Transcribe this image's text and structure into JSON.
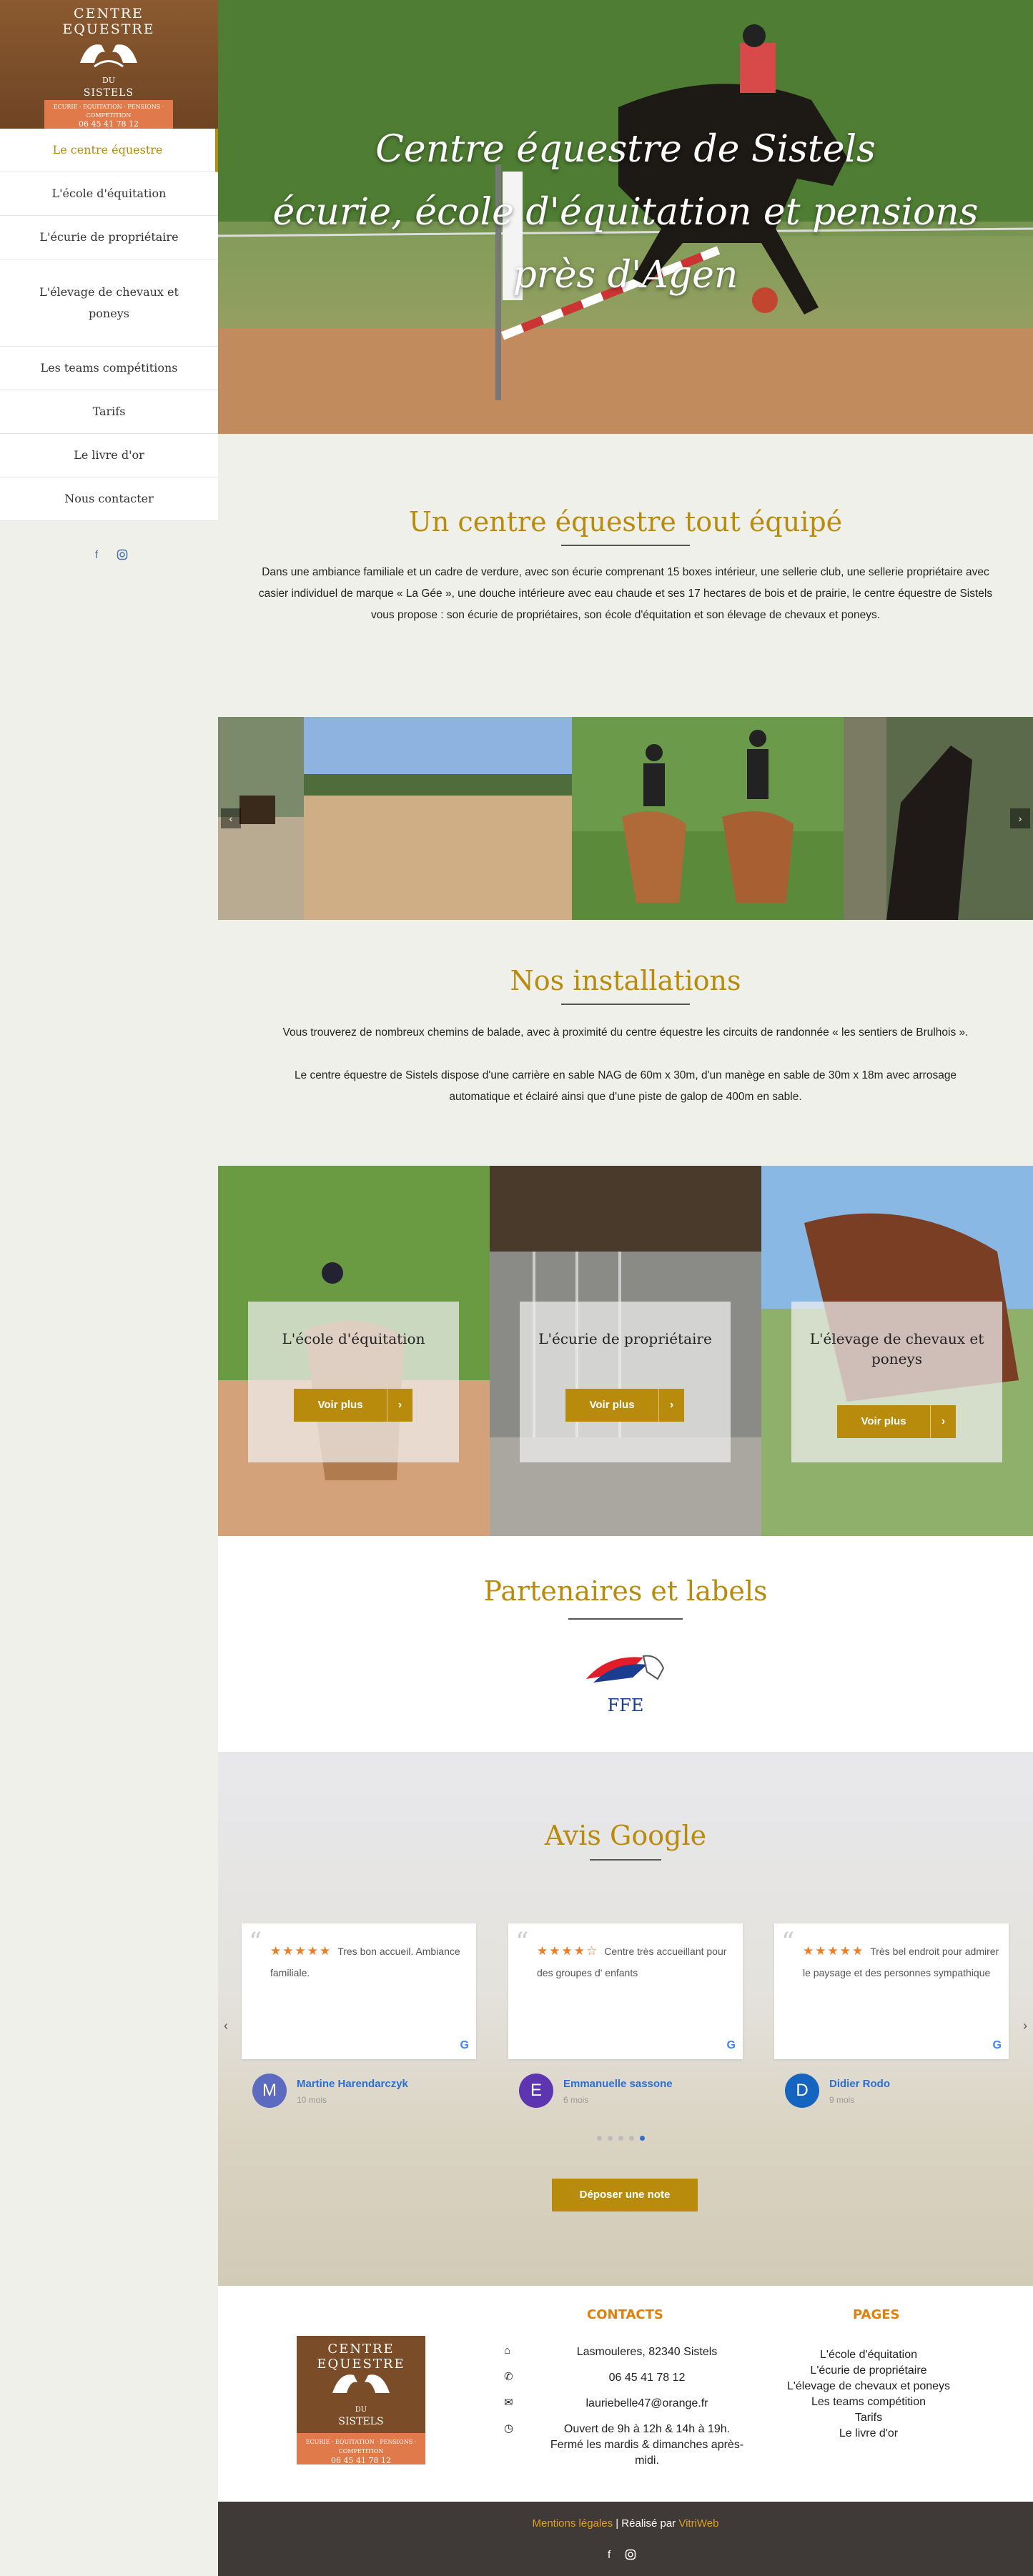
{
  "brand": {
    "logo_line1": "CENTRE  EQUESTRE",
    "logo_du": "DU",
    "logo_name": "SISTELS",
    "logo_band": "ECURIE · EQUITATION · PENSIONS · COMPETITION",
    "logo_phone": "06 45 41 78 12",
    "logo_color": "#7a4c27",
    "band_color": "#e07a4a"
  },
  "nav": {
    "items": [
      {
        "label": "Le centre équestre",
        "active": true
      },
      {
        "label": "L'école d'équitation"
      },
      {
        "label": "L'écurie de propriétaire"
      },
      {
        "label": "L'élevage de chevaux et poneys"
      },
      {
        "label": "Les teams compétitions"
      },
      {
        "label": "Tarifs"
      },
      {
        "label": "Le livre d'or"
      },
      {
        "label": "Nous contacter"
      }
    ],
    "social": [
      "facebook-icon",
      "instagram-icon"
    ]
  },
  "hero": {
    "line1": "Centre équestre de Sistels",
    "line2": "écurie, école d'équitation et pensions",
    "line3": "près d'Agen"
  },
  "section1": {
    "title": "Un centre équestre tout équipé",
    "text": "Dans une ambiance familiale et un cadre de verdure, avec son écurie comprenant 15 boxes intérieur, une sellerie club, une sellerie propriétaire avec casier individuel de marque « La Gée », une douche intérieure avec eau chaude et ses 17 hectares de bois et de prairie, le centre équestre de Sistels vous propose : son écurie de propriétaires, son école d'équitation et son élevage de chevaux et poneys."
  },
  "section2": {
    "title": "Nos installations",
    "text1": "Vous trouverez de nombreux chemins de balade, avec à proximité du centre équestre les circuits de randonnée « les sentiers de Brulhois ».",
    "text2": "Le centre équestre de Sistels dispose d'une carrière en sable NAG de 60m x 30m, d'un manège en sable de 30m x 18m avec arrosage automatique et éclairé ainsi que d'une piste de galop de 400m en sable."
  },
  "cards": [
    {
      "title": "L'école d'équitation",
      "button": "Voir plus"
    },
    {
      "title": "L'écurie de propriétaire",
      "button": "Voir plus"
    },
    {
      "title": "L'élevage de chevaux et poneys",
      "button": "Voir plus"
    }
  ],
  "partners": {
    "title": "Partenaires et labels",
    "logo_text": "FFE"
  },
  "reviews": {
    "title": "Avis Google",
    "items": [
      {
        "stars": "★★★★★",
        "text": "Tres bon accueil. Ambiance familiale.",
        "name": "Martine Harendarczyk",
        "date": "10 mois",
        "initial": "M",
        "color": "#5c6bc0"
      },
      {
        "stars": "★★★★☆",
        "text": "Centre très accueillant pour des groupes d' enfants",
        "name": "Emmanuelle sassone",
        "date": "6 mois",
        "initial": "E",
        "color": "#5e35b1"
      },
      {
        "stars": "★★★★★",
        "text": "Très bel endroit pour admirer le paysage et des personnes sympathique",
        "name": "Didier Rodo",
        "date": "9 mois",
        "initial": "D",
        "color": "#1565c0"
      }
    ],
    "google_letter": "G",
    "button": "Déposer une note",
    "prev": "‹",
    "next": "›"
  },
  "footer": {
    "contacts_title": "CONTACTS",
    "address": "Lasmouleres, 82340 Sistels",
    "phone": "06 45 41 78 12",
    "email": "lauriebelle47@orange.fr",
    "hours": "Ouvert de 9h à 12h & 14h à 19h. Fermé les mardis & dimanches après-midi.",
    "pages_title": "PAGES",
    "pages": [
      "L'école d'équitation",
      "L'écurie de propriétaire",
      "L'élevage de chevaux et poneys",
      "Les teams compétition",
      "Tarifs",
      "Le livre d'or"
    ],
    "legal": "Mentions légales",
    "sep": " | Réalisé par ",
    "agency": "VitriWeb",
    "accent": "#b98b0c"
  }
}
